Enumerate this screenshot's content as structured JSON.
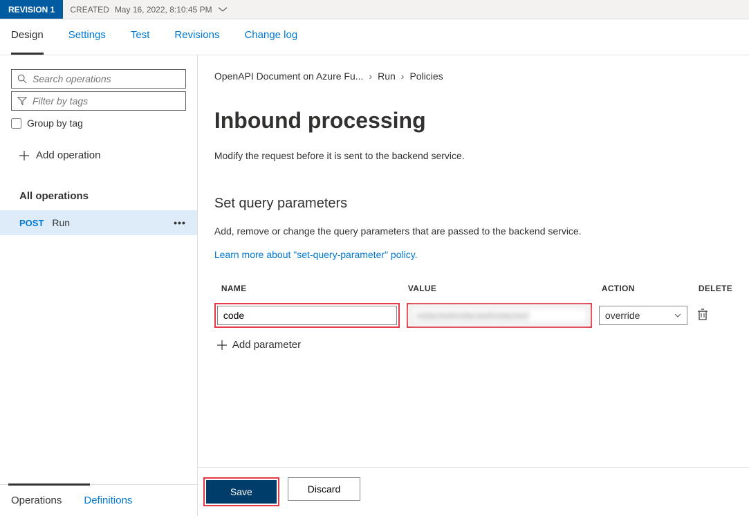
{
  "revision": {
    "badge": "REVISION 1",
    "created_label": "CREATED",
    "created_value": "May 16, 2022, 8:10:45 PM"
  },
  "top_tabs": {
    "design": "Design",
    "settings": "Settings",
    "test": "Test",
    "revisions": "Revisions",
    "changelog": "Change log"
  },
  "sidebar": {
    "search_placeholder": "Search operations",
    "filter_placeholder": "Filter by tags",
    "group_by_label": "Group by tag",
    "add_operation": "Add operation",
    "all_operations": "All operations",
    "operations": [
      {
        "method": "POST",
        "name": "Run"
      }
    ],
    "bottom_tabs": {
      "operations": "Operations",
      "definitions": "Definitions"
    }
  },
  "breadcrumb": {
    "item1": "OpenAPI Document on Azure Fu...",
    "item2": "Run",
    "item3": "Policies"
  },
  "content": {
    "title": "Inbound processing",
    "description": "Modify the request before it is sent to the backend service.",
    "section_title": "Set query parameters",
    "section_desc": "Add, remove or change the query parameters that are passed to the backend service.",
    "learn_more": "Learn more about \"set-query-parameter\" policy."
  },
  "param_table": {
    "headers": {
      "name": "NAME",
      "value": "VALUE",
      "action": "ACTION",
      "delete": "DELETE"
    },
    "rows": [
      {
        "name": "code",
        "value": "redactedredactedredacted",
        "action": "override"
      }
    ],
    "add_label": "Add parameter"
  },
  "footer": {
    "save": "Save",
    "discard": "Discard"
  }
}
